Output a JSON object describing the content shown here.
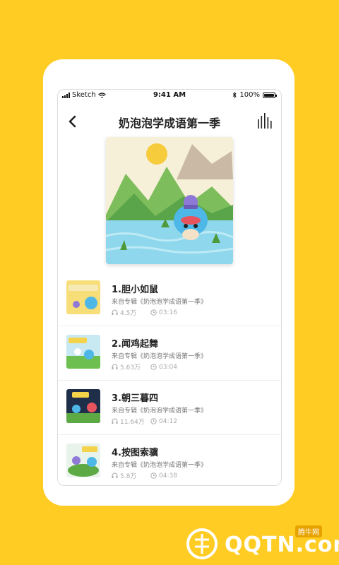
{
  "status_bar": {
    "carrier": "Sketch",
    "time": "9:41 AM",
    "battery": "100%"
  },
  "header": {
    "title": "奶泡泡学成语第一季"
  },
  "icons": {
    "back": "back-arrow-icon",
    "player": "equalizer-icon",
    "plays": "headphones-icon",
    "duration": "clock-icon"
  },
  "tracks": [
    {
      "title": "1.胆小如鼠",
      "album": "来自专辑《奶泡泡学成语第一季》",
      "plays": "4.5万",
      "duration": "03:16",
      "thumb_label": "胆小如鼠"
    },
    {
      "title": "2.闻鸡起舞",
      "album": "来自专辑《奶泡泡学成语第一季》",
      "plays": "5.63万",
      "duration": "03:04",
      "thumb_label": "闻鸡起舞"
    },
    {
      "title": "3.朝三暮四",
      "album": "来自专辑《奶泡泡学成语第一季》",
      "plays": "11.64万",
      "duration": "04:12",
      "thumb_label": "朝三暮四"
    },
    {
      "title": "4.按图索骥",
      "album": "来自专辑《奶泡泡学成语第一季》",
      "plays": "5.8万",
      "duration": "04:38",
      "thumb_label": "按图索骥"
    }
  ],
  "watermark": {
    "text": "QQTN.com",
    "badge": "腾牛网"
  },
  "colors": {
    "background": "#FFCC23",
    "card": "#FFFFFF"
  }
}
